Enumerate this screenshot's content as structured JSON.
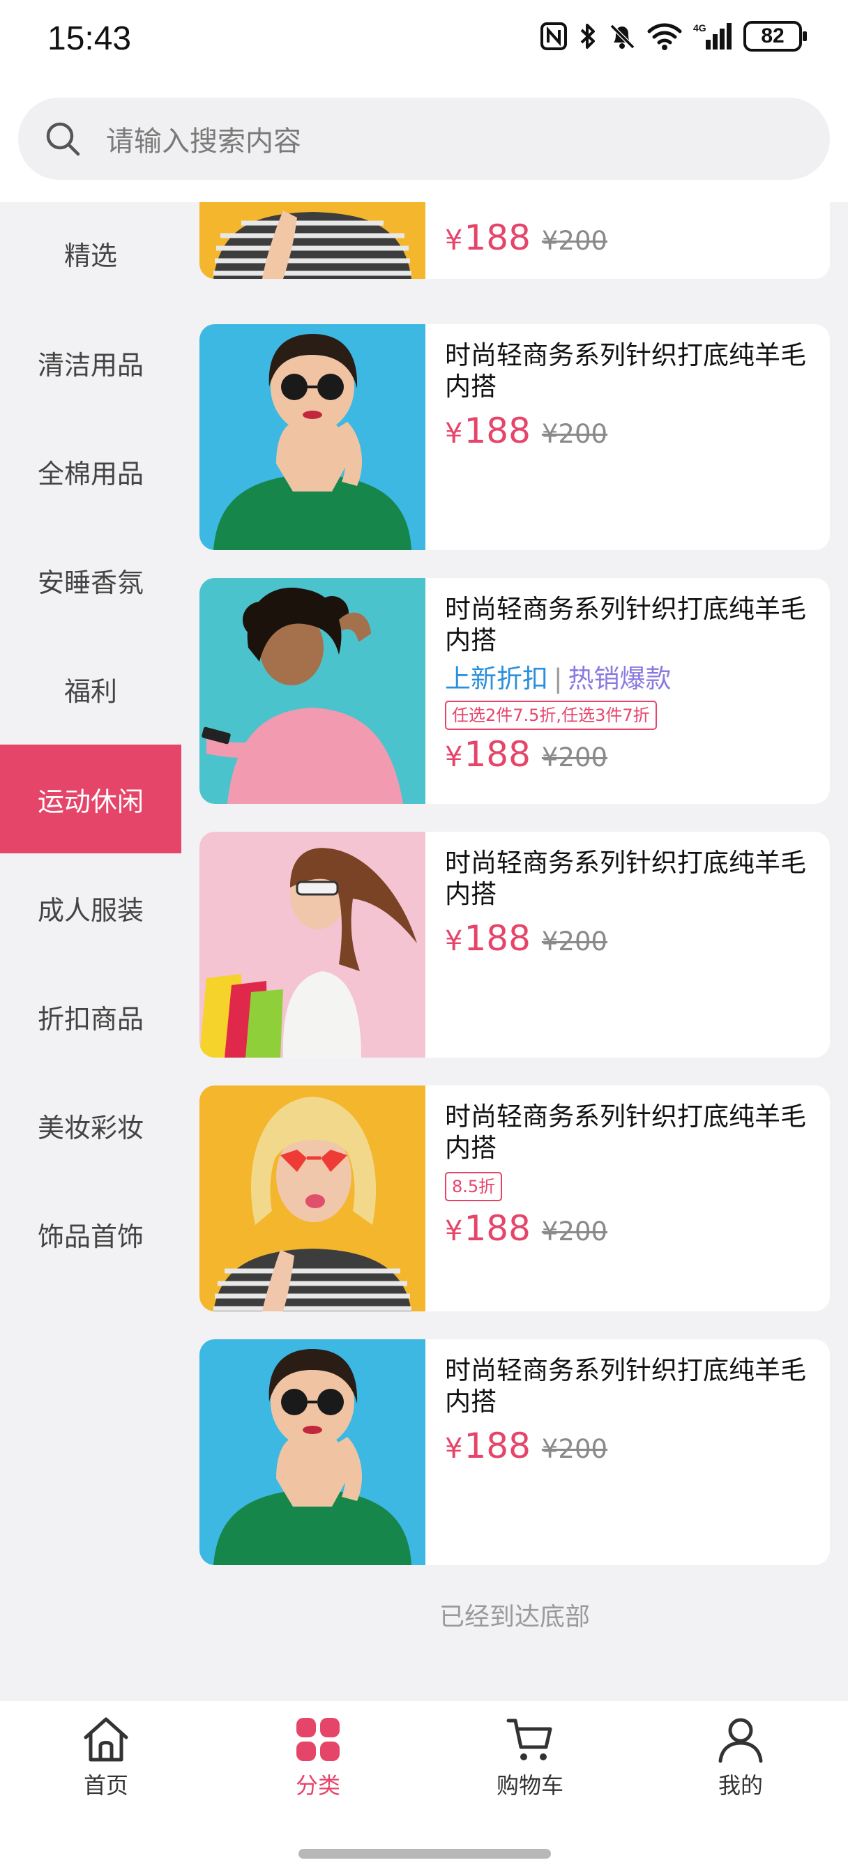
{
  "status_bar": {
    "time": "15:43",
    "battery": "82"
  },
  "search": {
    "placeholder": "请输入搜索内容"
  },
  "sidebar": {
    "items": [
      {
        "label": "精选"
      },
      {
        "label": "清洁用品"
      },
      {
        "label": "全棉用品"
      },
      {
        "label": "安睡香氛"
      },
      {
        "label": "福利"
      },
      {
        "label": "运动休闲"
      },
      {
        "label": "成人服装"
      },
      {
        "label": "折扣商品"
      },
      {
        "label": "美妆彩妆"
      },
      {
        "label": "饰品首饰"
      }
    ],
    "active_label": "运动休闲"
  },
  "products": [
    {
      "title": "",
      "price": "188",
      "old_price": "¥200",
      "image": "woman-striped-shirt-yellow-bg"
    },
    {
      "title": "时尚轻商务系列针织打底纯羊毛内搭",
      "price": "188",
      "old_price": "¥200",
      "image": "woman-green-shirt-sunglasses-blue-bg"
    },
    {
      "title": "时尚轻商务系列针织打底纯羊毛内搭",
      "tag_new": "上新折扣",
      "tag_sep": "|",
      "tag_hot": "热销爆款",
      "promo": "任选2件7.5折,任选3件7折",
      "price": "188",
      "old_price": "¥200",
      "image": "woman-pink-sweater-phone-teal-bg"
    },
    {
      "title": "时尚轻商务系列针织打底纯羊毛内搭",
      "price": "188",
      "old_price": "¥200",
      "image": "woman-shopping-bags-pink-bg"
    },
    {
      "title": "时尚轻商务系列针织打底纯羊毛内搭",
      "promo": "8.5折",
      "price": "188",
      "old_price": "¥200",
      "image": "woman-heart-glasses-yellow-bg"
    },
    {
      "title": "时尚轻商务系列针织打底纯羊毛内搭",
      "price": "188",
      "old_price": "¥200",
      "image": "woman-green-shirt-sunglasses-blue-bg"
    }
  ],
  "currency_symbol": "¥",
  "list_end_text": "已经到达底部",
  "tabbar": {
    "home": "首页",
    "category": "分类",
    "cart": "购物车",
    "mine": "我的"
  },
  "colors": {
    "accent": "#e6456a",
    "tag_new": "#2a8fdc",
    "tag_hot": "#8a7ae0"
  },
  "icons": [
    "nfc-icon",
    "bluetooth-icon",
    "mute-icon",
    "wifi-icon",
    "signal-icon",
    "battery-icon",
    "search-icon",
    "home-icon",
    "category-icon",
    "cart-icon",
    "user-icon"
  ]
}
